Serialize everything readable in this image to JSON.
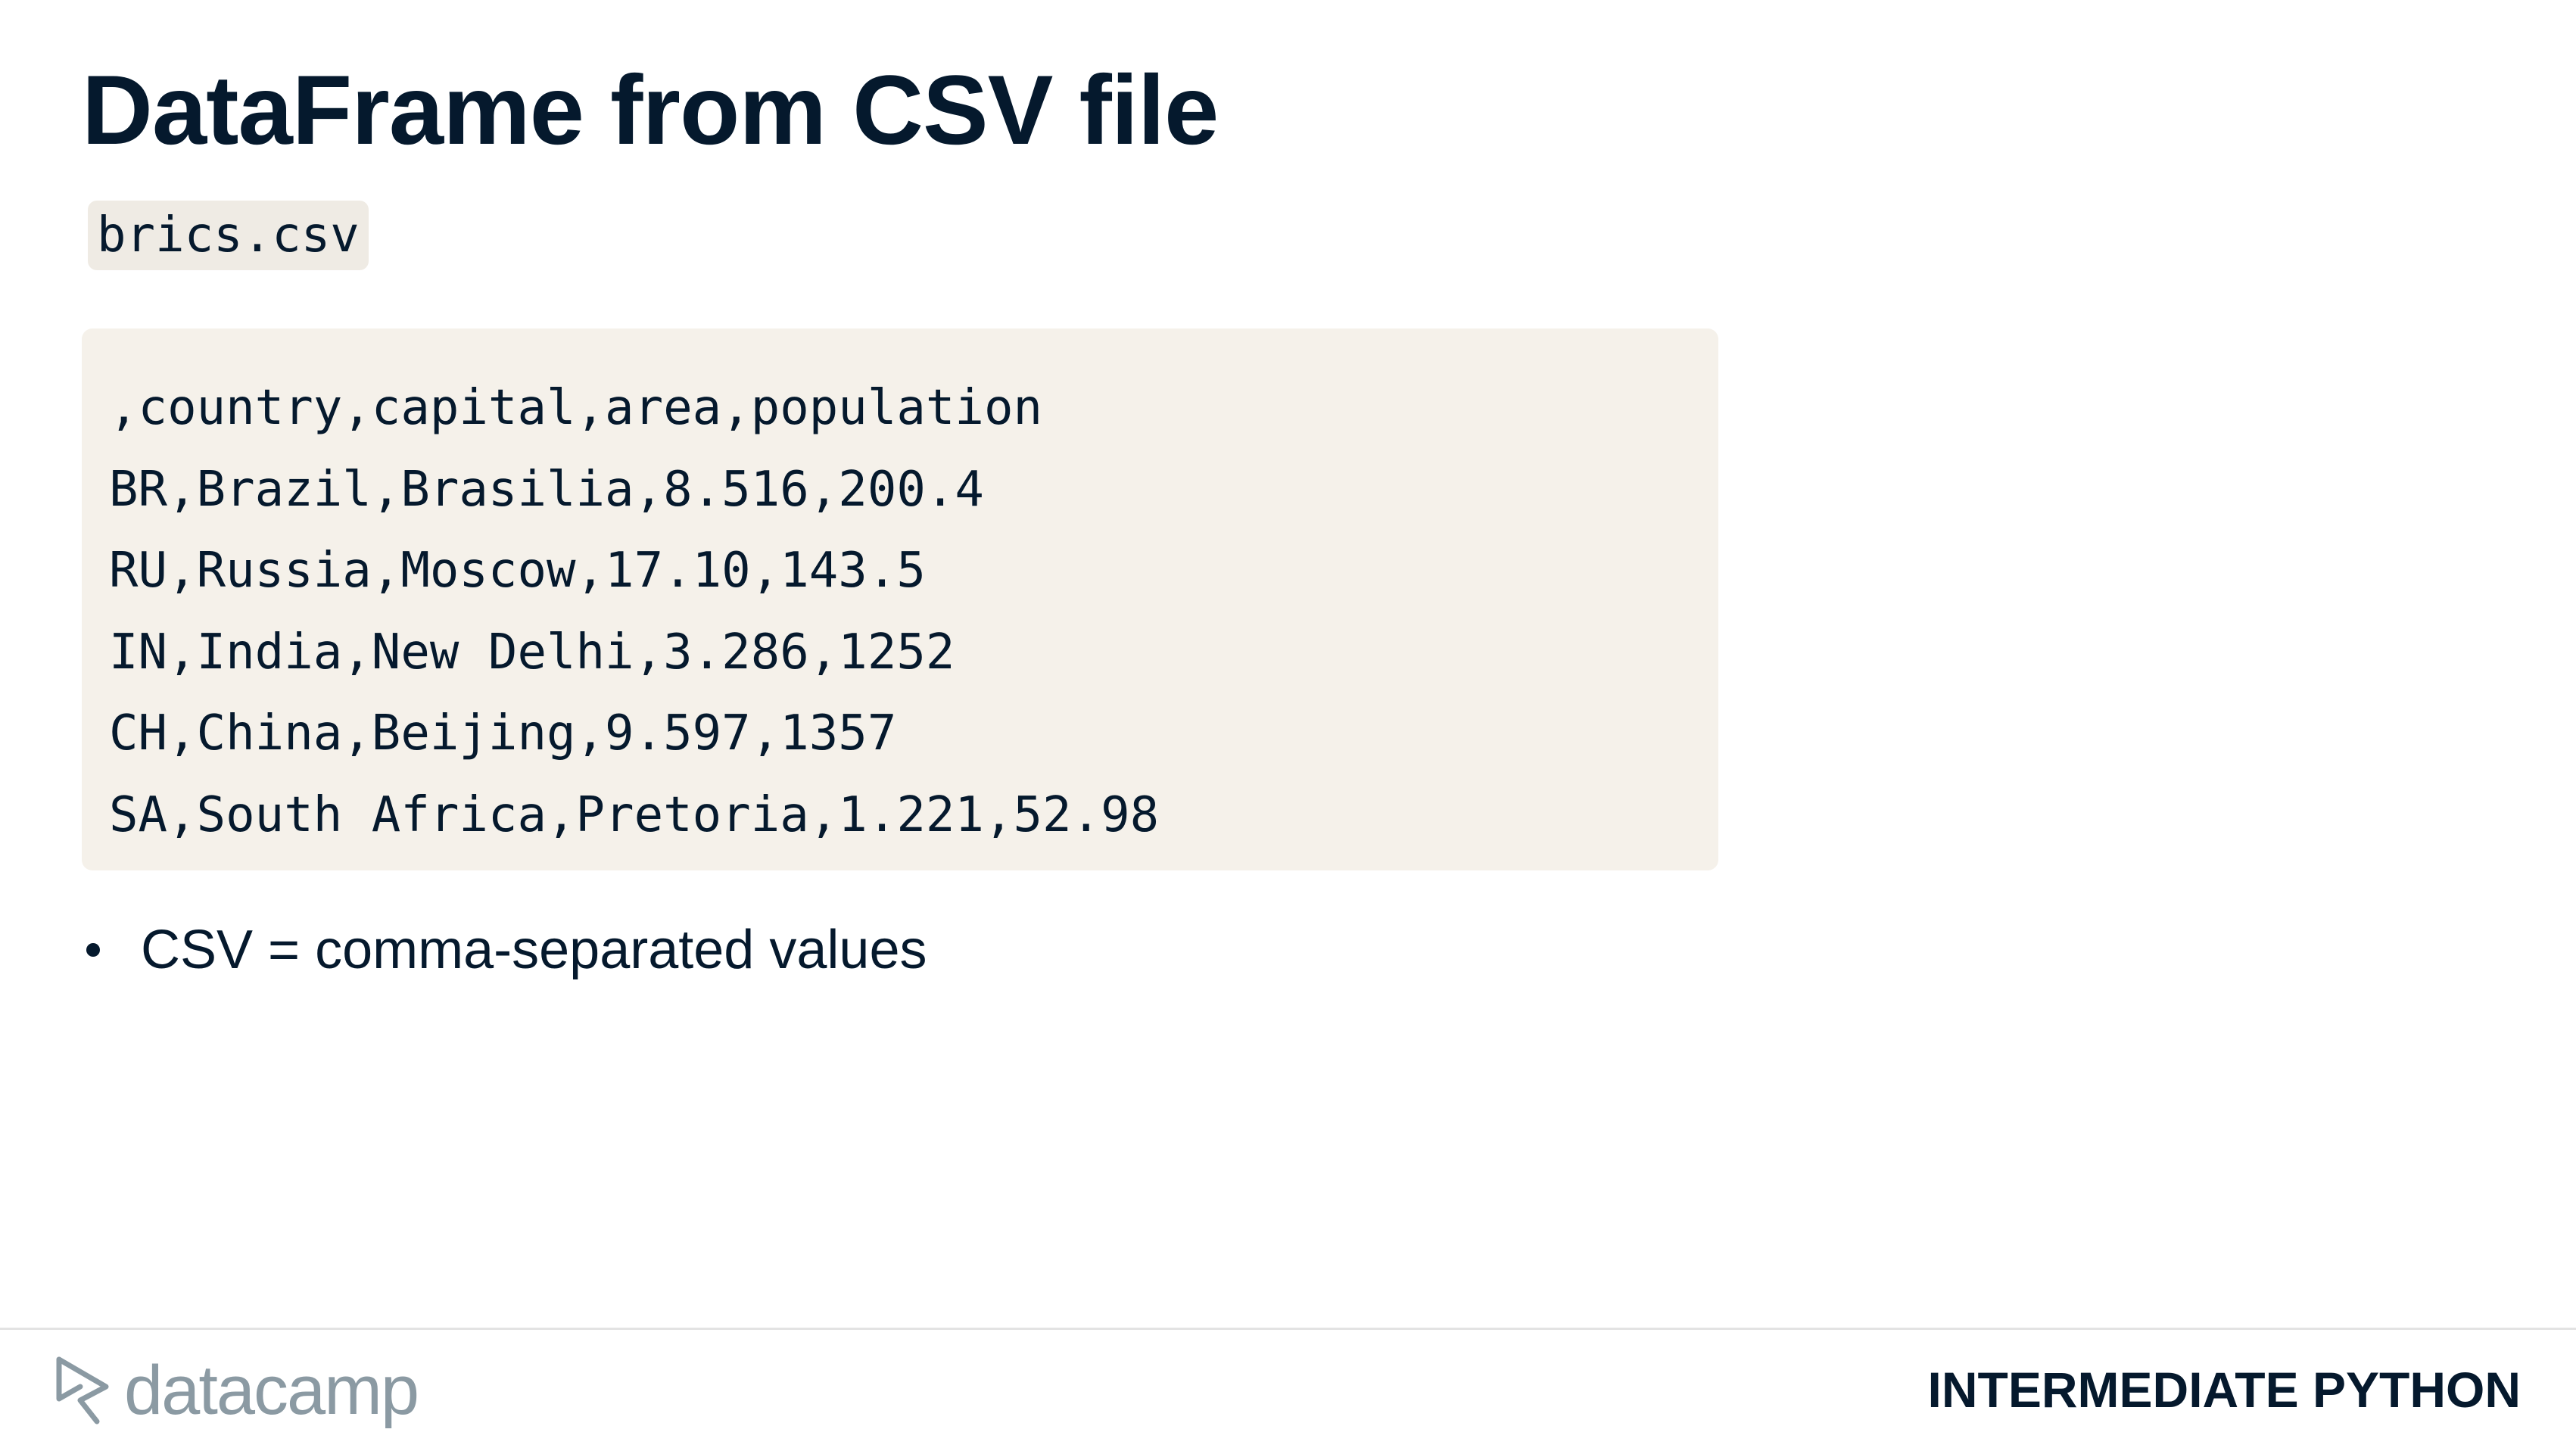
{
  "slide": {
    "title": "DataFrame from CSV file",
    "file_name": "brics.csv"
  },
  "code_block": {
    "lines": [
      ",country,capital,area,population",
      "BR,Brazil,Brasilia,8.516,200.4",
      "RU,Russia,Moscow,17.10,143.5",
      "IN,India,New Delhi,3.286,1252",
      "CH,China,Beijing,9.597,1357",
      "SA,South Africa,Pretoria,1.221,52.98"
    ]
  },
  "bullets": [
    "CSV = comma-separated values"
  ],
  "footer": {
    "logo_text": "datacamp",
    "logo_icon": "datacamp-logo-icon",
    "course": "INTERMEDIATE PYTHON"
  },
  "colors": {
    "text": "#05192d",
    "code_background": "#f5f1ea",
    "logo": "#8b9aa3"
  }
}
